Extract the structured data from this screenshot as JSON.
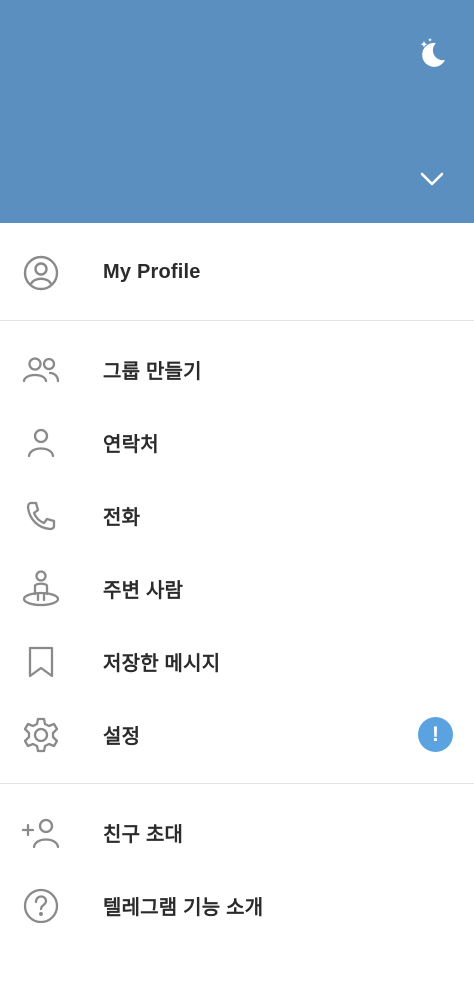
{
  "header": {
    "color": "#5a8fbf",
    "theme_icon": "moon-icon",
    "expand_icon": "chevron-down-icon"
  },
  "profile": {
    "label": "My Profile",
    "icon": "profile-circle-icon"
  },
  "menu": [
    {
      "id": "new-group",
      "label": "그룹 만들기",
      "icon": "group-icon"
    },
    {
      "id": "contacts",
      "label": "연락처",
      "icon": "person-icon"
    },
    {
      "id": "calls",
      "label": "전화",
      "icon": "phone-icon"
    },
    {
      "id": "people-nearby",
      "label": "주변 사람",
      "icon": "nearby-icon"
    },
    {
      "id": "saved-messages",
      "label": "저장한 메시지",
      "icon": "bookmark-icon"
    },
    {
      "id": "settings",
      "label": "설정",
      "icon": "gear-icon",
      "badge": "!"
    }
  ],
  "footer_menu": [
    {
      "id": "invite-friends",
      "label": "친구 초대",
      "icon": "add-person-icon"
    },
    {
      "id": "features",
      "label": "텔레그램 기능 소개",
      "icon": "question-icon"
    }
  ],
  "colors": {
    "badge": "#5aa3e0",
    "icon": "#8a8a8a",
    "divider": "#e3e3e3"
  }
}
